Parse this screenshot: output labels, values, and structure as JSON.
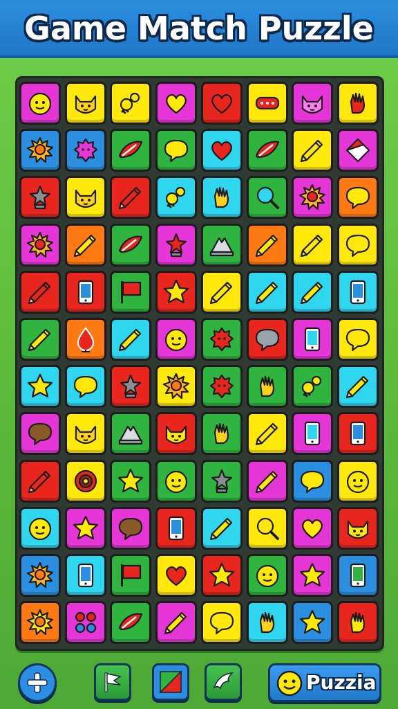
{
  "header": {
    "title": "Game Match Puzzle"
  },
  "colors": {
    "M": "#e636d8",
    "Y": "#ffe80a",
    "R": "#e8261e",
    "B": "#2a8fe0",
    "G": "#2fb53f",
    "O": "#ff7a12",
    "C": "#2fd6f0"
  },
  "board": {
    "rows": [
      [
        [
          "M",
          "face"
        ],
        [
          "Y",
          "cat"
        ],
        [
          "Y",
          "key"
        ],
        [
          "M",
          "heart"
        ],
        [
          "R",
          "heart"
        ],
        [
          "Y",
          "sign"
        ],
        [
          "M",
          "cat"
        ],
        [
          "Y",
          "hand"
        ]
      ],
      [
        [
          "B",
          "sun"
        ],
        [
          "B",
          "blob"
        ],
        [
          "G",
          "leaf"
        ],
        [
          "G",
          "speech"
        ],
        [
          "C",
          "heart"
        ],
        [
          "G",
          "leaf"
        ],
        [
          "Y",
          "pencil"
        ],
        [
          "M",
          "diamond"
        ]
      ],
      [
        [
          "R",
          "trophy"
        ],
        [
          "Y",
          "cat"
        ],
        [
          "R",
          "pencil"
        ],
        [
          "C",
          "key"
        ],
        [
          "C",
          "hand"
        ],
        [
          "G",
          "magnifier"
        ],
        [
          "M",
          "sun"
        ],
        [
          "O",
          "speech"
        ]
      ],
      [
        [
          "M",
          "sun"
        ],
        [
          "O",
          "pencil"
        ],
        [
          "G",
          "leaf"
        ],
        [
          "M",
          "trophy"
        ],
        [
          "G",
          "mountain"
        ],
        [
          "O",
          "pencil"
        ],
        [
          "Y",
          "pencil"
        ],
        [
          "Y",
          "speech"
        ]
      ],
      [
        [
          "R",
          "pencil"
        ],
        [
          "R",
          "phone"
        ],
        [
          "G",
          "flag"
        ],
        [
          "R",
          "star"
        ],
        [
          "Y",
          "pencil"
        ],
        [
          "C",
          "pencil"
        ],
        [
          "C",
          "pencil"
        ],
        [
          "C",
          "phone"
        ]
      ],
      [
        [
          "G",
          "pencil"
        ],
        [
          "O",
          "drop"
        ],
        [
          "C",
          "pencil"
        ],
        [
          "M",
          "face"
        ],
        [
          "G",
          "blob"
        ],
        [
          "R",
          "speech"
        ],
        [
          "M",
          "phone"
        ],
        [
          "Y",
          "speech"
        ]
      ],
      [
        [
          "C",
          "star"
        ],
        [
          "C",
          "speech"
        ],
        [
          "R",
          "trophy"
        ],
        [
          "Y",
          "sun"
        ],
        [
          "G",
          "blob"
        ],
        [
          "G",
          "hand"
        ],
        [
          "G",
          "key"
        ],
        [
          "C",
          "pencil"
        ]
      ],
      [
        [
          "M",
          "speech"
        ],
        [
          "Y",
          "cat"
        ],
        [
          "G",
          "mountain"
        ],
        [
          "R",
          "cat"
        ],
        [
          "G",
          "hand"
        ],
        [
          "Y",
          "pencil"
        ],
        [
          "M",
          "phone"
        ],
        [
          "R",
          "phone"
        ]
      ],
      [
        [
          "R",
          "pencil"
        ],
        [
          "Y",
          "target"
        ],
        [
          "G",
          "star"
        ],
        [
          "G",
          "face"
        ],
        [
          "G",
          "trophy"
        ],
        [
          "M",
          "pencil"
        ],
        [
          "B",
          "speech"
        ],
        [
          "Y",
          "face"
        ]
      ],
      [
        [
          "C",
          "face"
        ],
        [
          "M",
          "star"
        ],
        [
          "M",
          "speech"
        ],
        [
          "R",
          "phone"
        ],
        [
          "C",
          "pencil"
        ],
        [
          "Y",
          "magnifier"
        ],
        [
          "M",
          "heart"
        ],
        [
          "R",
          "cat"
        ]
      ],
      [
        [
          "B",
          "sun"
        ],
        [
          "C",
          "phone"
        ],
        [
          "G",
          "flag"
        ],
        [
          "Y",
          "heart"
        ],
        [
          "R",
          "star"
        ],
        [
          "G",
          "face"
        ],
        [
          "M",
          "star"
        ],
        [
          "B",
          "phone"
        ]
      ],
      [
        [
          "O",
          "sun"
        ],
        [
          "M",
          "dots"
        ],
        [
          "G",
          "leaf"
        ],
        [
          "M",
          "pencil"
        ],
        [
          "Y",
          "speech"
        ],
        [
          "C",
          "hand"
        ],
        [
          "B",
          "star"
        ],
        [
          "R",
          "hand"
        ]
      ]
    ]
  },
  "toolbar": {
    "add_icon": "plus-icon",
    "flag_icon": "flag-icon",
    "shuffle_icon": "diagonal-split-icon",
    "bird_icon": "bird-icon",
    "named_button_label": "Puzzia"
  }
}
